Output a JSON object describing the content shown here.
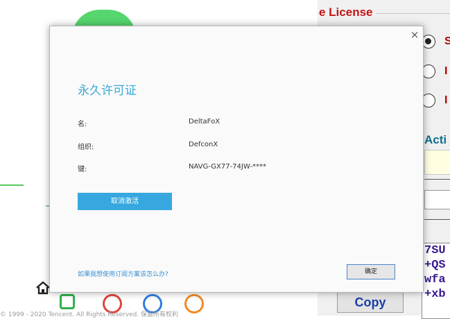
{
  "background": {
    "license_group_title": "e License",
    "radio_options": [
      {
        "label": "S",
        "selected": true
      },
      {
        "label": "I",
        "selected": false
      },
      {
        "label": "I",
        "selected": false
      }
    ],
    "activate_label": "Acti",
    "key_lines": [
      "7SU",
      "+QS",
      "wfa",
      "+xb"
    ],
    "copy_button": "Copy",
    "footer_text": "© 1999 - 2020 Tencent. All Rights Reserved. 保留所有权利"
  },
  "dialog": {
    "title": "永久许可证",
    "close_glyph": "×",
    "rows": [
      {
        "label": "名:",
        "value": "DeltaFoX"
      },
      {
        "label": "组织:",
        "value": "DefconX"
      },
      {
        "label": "键:",
        "value": "NAVG-GX77-74JW-****"
      }
    ],
    "deactivate_button": "取消激活",
    "subscription_link": "如果我想使用订阅方案该怎么办?",
    "ok_button": "确定"
  },
  "colors": {
    "accent": "#36a8df",
    "title": "#3aa8d8",
    "license_red": "#c41414"
  },
  "icons": [
    "home-icon",
    "close-icon"
  ]
}
